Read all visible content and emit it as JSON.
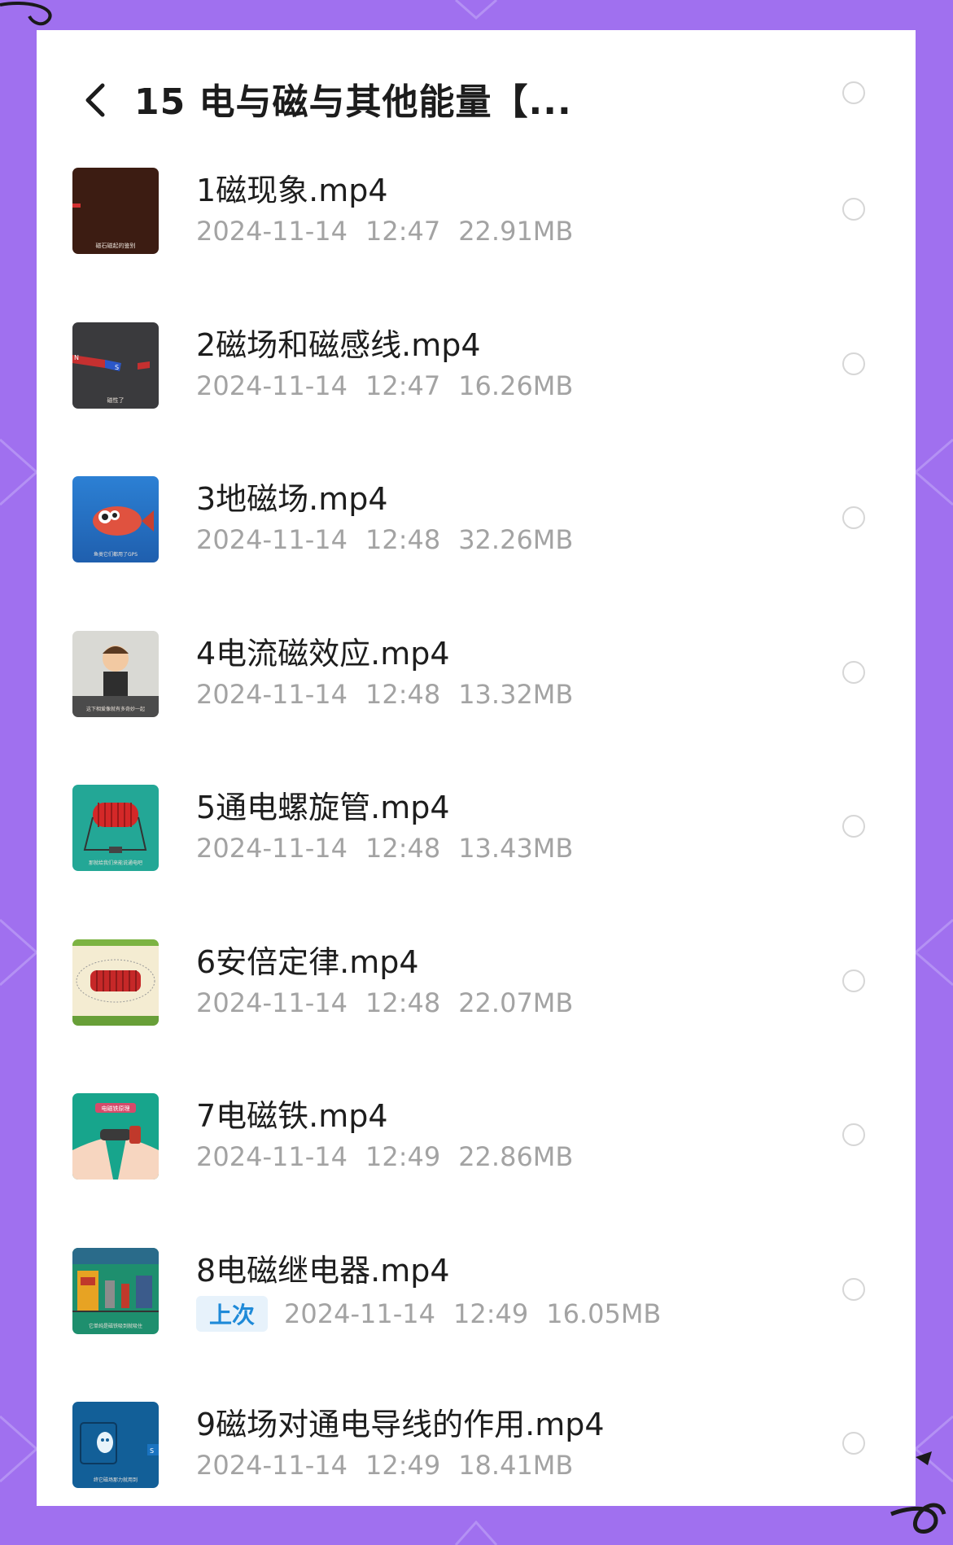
{
  "header": {
    "title": "15 电与磁与其他能量【..."
  },
  "files": [
    {
      "name": "1磁现象.mp4",
      "date": "2024-11-14",
      "time": "12:47",
      "size": "22.91MB",
      "thumb_caption": "磁石磁起的鉴别"
    },
    {
      "name": "2磁场和磁感线.mp4",
      "date": "2024-11-14",
      "time": "12:47",
      "size": "16.26MB",
      "thumb_caption": "磁性了"
    },
    {
      "name": "3地磁场.mp4",
      "date": "2024-11-14",
      "time": "12:48",
      "size": "32.26MB",
      "thumb_caption": "鱼类它们都用了GPS"
    },
    {
      "name": "4电流磁效应.mp4",
      "date": "2024-11-14",
      "time": "12:48",
      "size": "13.32MB",
      "thumb_caption": "这下相爱像就有多奇妙一起"
    },
    {
      "name": "5通电螺旋管.mp4",
      "date": "2024-11-14",
      "time": "12:48",
      "size": "13.43MB",
      "thumb_caption": "那就给我们来能说通电吧"
    },
    {
      "name": "6安倍定律.mp4",
      "date": "2024-11-14",
      "time": "12:48",
      "size": "22.07MB",
      "thumb_caption": ""
    },
    {
      "name": "7电磁铁.mp4",
      "date": "2024-11-14",
      "time": "12:49",
      "size": "22.86MB",
      "thumb_caption": "电磁铁原理"
    },
    {
      "name": "8电磁继电器.mp4",
      "badge": "上次",
      "date": "2024-11-14",
      "time": "12:49",
      "size": "16.05MB",
      "thumb_caption": "它单纯是磁铁吸到就吸住"
    },
    {
      "name": "9磁场对通电导线的作用.mp4",
      "date": "2024-11-14",
      "time": "12:49",
      "size": "18.41MB",
      "thumb_caption": "终它磁场那力就用到"
    }
  ],
  "colors": {
    "background": "#a070ef",
    "badge_text": "#1f8ad8",
    "badge_bg": "#e7f2fb"
  }
}
